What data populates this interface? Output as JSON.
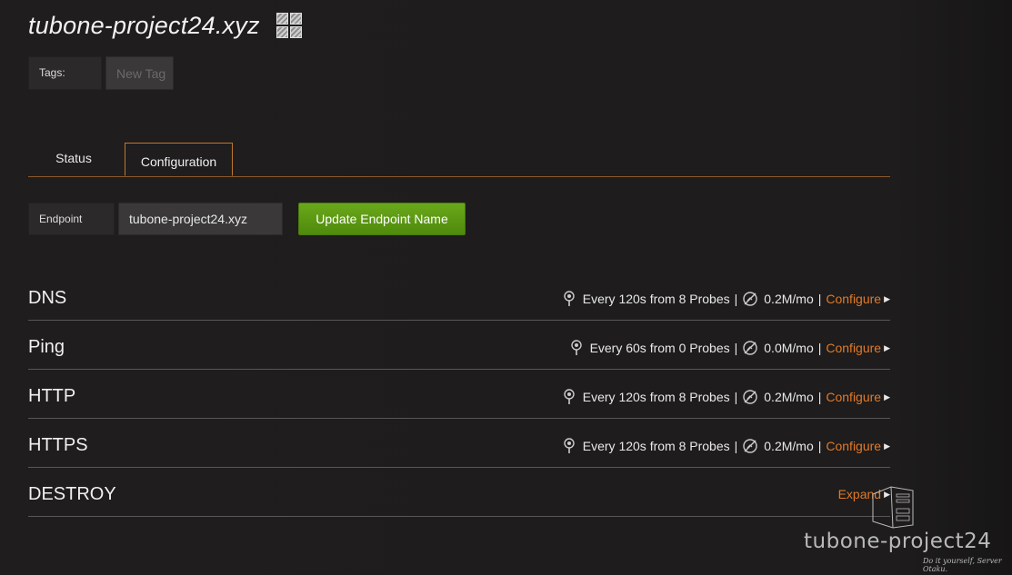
{
  "header": {
    "title": "tubone-project24.xyz",
    "icon": "grid-icon"
  },
  "tags": {
    "label": "Tags:",
    "placeholder": "New Tag"
  },
  "tabs": [
    {
      "label": "Status",
      "active": false
    },
    {
      "label": "Configuration",
      "active": true
    }
  ],
  "endpoint": {
    "label": "Endpoint",
    "value": "tubone-project24.xyz",
    "button_label": "Update Endpoint Name"
  },
  "sections": [
    {
      "name": "DNS",
      "frequency": "Every 120s from 8 Probes",
      "bandwidth": "0.2M/mo",
      "action": "Configure"
    },
    {
      "name": "Ping",
      "frequency": "Every 60s from 0 Probes",
      "bandwidth": "0.0M/mo",
      "action": "Configure"
    },
    {
      "name": "HTTP",
      "frequency": "Every 120s from 8 Probes",
      "bandwidth": "0.2M/mo",
      "action": "Configure"
    },
    {
      "name": "HTTPS",
      "frequency": "Every 120s from 8 Probes",
      "bandwidth": "0.2M/mo",
      "action": "Configure"
    }
  ],
  "destroy": {
    "name": "DESTROY",
    "action": "Expand"
  },
  "separator": "|",
  "watermark": {
    "brand": "tubone-project24",
    "slogan": "Do it yourself, Server Otaku."
  },
  "colors": {
    "accent": "#e07a2a",
    "button": "#5e9a14",
    "background": "#1e1c1c"
  }
}
